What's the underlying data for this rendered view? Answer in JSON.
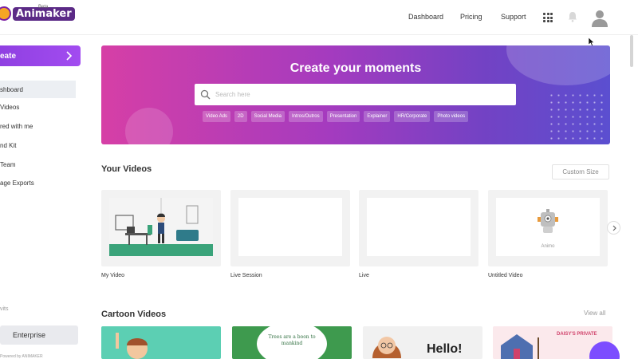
{
  "header": {
    "logo_text": "Animaker",
    "logo_badge": "Beta",
    "nav": [
      "Dashboard",
      "Pricing",
      "Support"
    ]
  },
  "sidebar": {
    "create_label": "eate",
    "items": [
      "shboard",
      "Videos",
      "red with me",
      "nd Kit",
      "Team",
      "age Exports"
    ],
    "muted_fragment": "vits",
    "enterprise_label": "Enterprise",
    "powered_by": "Powered by ANIMAKER"
  },
  "banner": {
    "title": "Create your moments",
    "search_placeholder": "Search here",
    "chips": [
      "Video Ads",
      "2D",
      "Social Media",
      "Intros/Outros",
      "Presentation",
      "Explainer",
      "HR/Corporate",
      "Photo videos"
    ]
  },
  "your_videos": {
    "title": "Your Videos",
    "custom_size_label": "Custom Size",
    "cards": [
      "My Video",
      "Live Session",
      "Live",
      "Untitled Video"
    ],
    "animo_label": "Animo"
  },
  "cartoon_videos": {
    "title": "Cartoon Videos",
    "view_all_label": "View all",
    "tile_texts": [
      "Trees are a boon to mankind",
      "Hello!",
      "DAISY'S PRIVATE"
    ]
  },
  "colors": {
    "accent": "#8e3fe0",
    "banner_start": "#d63fa6",
    "banner_end": "#5b4fd0"
  }
}
